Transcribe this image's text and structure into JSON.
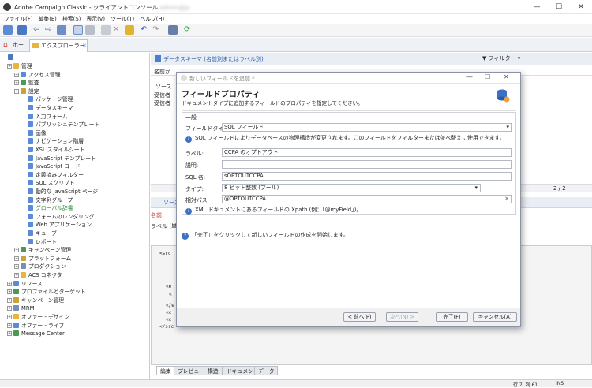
{
  "window": {
    "title": "Adobe Campaign Classic - クライアントコンソール",
    "user_redacted": "admin@jp"
  },
  "menu": [
    "ファイル(F)",
    "編集(E)",
    "検索(S)",
    "表示(V)",
    "ツール(T)",
    "ヘルプ(H)"
  ],
  "tabs": [
    {
      "label": "ホーム"
    },
    {
      "label": "エクスプローラー"
    }
  ],
  "tree": [
    {
      "label": "管理",
      "indent": 1
    },
    {
      "label": "アクセス管理",
      "indent": 2
    },
    {
      "label": "監査",
      "indent": 2
    },
    {
      "label": "設定",
      "indent": 2
    },
    {
      "label": "パッケージ管理",
      "indent": 3
    },
    {
      "label": "データスキーマ",
      "indent": 3
    },
    {
      "label": "入力フォーム",
      "indent": 3
    },
    {
      "label": "パブリッシュテンプレート",
      "indent": 3
    },
    {
      "label": "画像",
      "indent": 3
    },
    {
      "label": "ナビゲーション階層",
      "indent": 3
    },
    {
      "label": "XSL スタイルシート",
      "indent": 3
    },
    {
      "label": "JavaScript テンプレート",
      "indent": 3
    },
    {
      "label": "JavaScript コード",
      "indent": 3
    },
    {
      "label": "定義済みフィルター",
      "indent": 3
    },
    {
      "label": "SQL スクリプト",
      "indent": 3
    },
    {
      "label": "動的な JavaScript ページ",
      "indent": 3
    },
    {
      "label": "文字列グループ",
      "indent": 3
    },
    {
      "label": "グローバル辞書",
      "indent": 3
    },
    {
      "label": "フォームのレンダリング",
      "indent": 3
    },
    {
      "label": "Web アプリケーション",
      "indent": 3
    },
    {
      "label": "キューブ",
      "indent": 3
    },
    {
      "label": "レポート",
      "indent": 3
    },
    {
      "label": "キャンペーン管理",
      "indent": 2
    },
    {
      "label": "プラットフォーム",
      "indent": 2
    },
    {
      "label": "プロダクション",
      "indent": 2
    },
    {
      "label": "ACS コネクタ",
      "indent": 2
    },
    {
      "label": "リソース",
      "indent": 1
    },
    {
      "label": "プロファイルとターゲット",
      "indent": 1
    },
    {
      "label": "キャンペーン管理",
      "indent": 1
    },
    {
      "label": "MRM",
      "indent": 1
    },
    {
      "label": "オファー - デザイン",
      "indent": 1
    },
    {
      "label": "オファー - ライブ",
      "indent": 1
    },
    {
      "label": "Message Center",
      "indent": 1
    }
  ],
  "schema_panel": {
    "title": "データスキーマ (名前別またはラベル別)",
    "filter": "フィルター",
    "col_name": "名前か",
    "col_source": "ソース",
    "rows": [
      "受信者",
      "受信者"
    ],
    "count": "2 / 2"
  },
  "detail_panel": {
    "title": "ソース",
    "name_label": "名前:",
    "label_label": "ラベル (単数",
    "code_lines": [
      "<src",
      "<e",
      "<",
      "</e",
      "<c",
      "<c",
      "</src"
    ]
  },
  "bottom_tabs": [
    "編集",
    "プレビュー",
    "構造",
    "ドキュメント",
    "データ"
  ],
  "status": {
    "position": "行 7, 列 61",
    "mode": "INS"
  },
  "dialog": {
    "window_title": "新しいフィールドを追加 *",
    "heading": "フィールドプロパティ",
    "subheading": "ドキュメントタイプに追加するフィールドのプロパティを指定してください。",
    "section": "一般",
    "field_type_label": "フィールドタイプ:",
    "field_type_value": "SQL フィールド",
    "field_type_info": "SQL フィールドによりデータベースの物理構造が変更されます。このフィールドをフィルターまたは並べ替えに使用できます。",
    "label_label": "ラベル:",
    "label_value": "CCPA のオプトアウト",
    "desc_label": "説明:",
    "desc_value": "",
    "sqlname_label": "SQL 名:",
    "sqlname_value": "sOPTOUTCCPA",
    "type_label": "タイプ:",
    "type_value": "8 ビット整数 (ブール)",
    "xpath_label": "相対パス:",
    "xpath_value": "@OPTOUTCCPA",
    "xpath_info": "XML ドキュメントにあるフィールドの Xpath (例：「@myField」)。",
    "finish_info": "「完了」をクリックして新しいフィールドの作成を開始します。",
    "btn_back": "< 前へ(P)",
    "btn_next": "次へ(N) >",
    "btn_finish": "完了(F)",
    "btn_cancel": "キャンセル(A)"
  }
}
